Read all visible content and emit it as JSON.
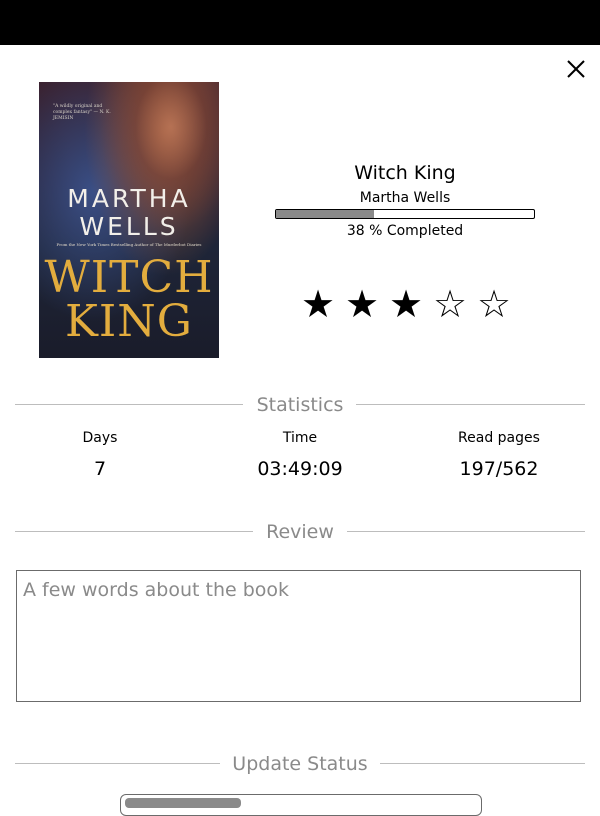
{
  "book": {
    "title": "Witch King",
    "author": "Martha Wells",
    "progress_percent": 38,
    "progress_text": "38 % Completed",
    "rating": {
      "value": 3,
      "max": 5,
      "filled_glyph": "★",
      "empty_glyph": "☆"
    }
  },
  "cover": {
    "blurb": "\"A wildly original and complex fantasy\" — N. K. JEMISIN",
    "author_line1": "MARTHA",
    "author_line2": "WELLS",
    "tagline": "From the New York Times Bestselling Author of The Murderbot Diaries",
    "title_line1": "WITCH",
    "title_line2": "KING",
    "title_color": "#e3ad3e"
  },
  "statistics": {
    "header": "Statistics",
    "items": [
      {
        "label": "Days",
        "value": "7"
      },
      {
        "label": "Time",
        "value": "03:49:09"
      },
      {
        "label": "Read pages",
        "value": "197/562"
      }
    ]
  },
  "review": {
    "header": "Review",
    "placeholder": "A few words about the book",
    "value": ""
  },
  "update_status": {
    "header": "Update Status"
  },
  "icons": {
    "close": "close-icon"
  },
  "colors": {
    "status_bar": "#000000",
    "divider": "#bdbdbd",
    "muted_text": "#8a8a8a",
    "progress_fill": "#8a8a8a"
  }
}
